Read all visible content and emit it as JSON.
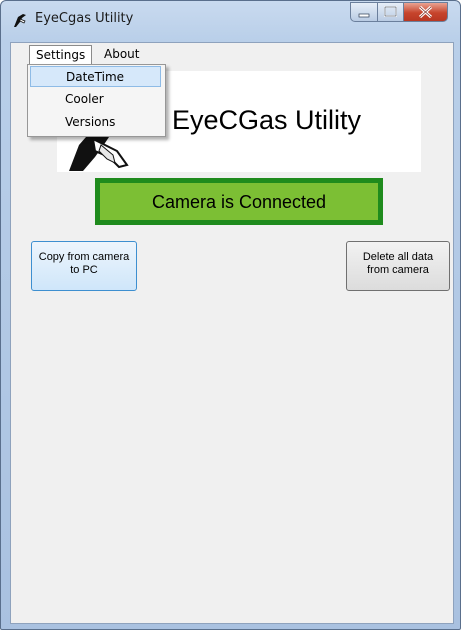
{
  "window": {
    "title": "EyeCgas Utility"
  },
  "menu": {
    "items": [
      {
        "label": "Settings"
      },
      {
        "label": "About"
      }
    ],
    "dropdown": [
      {
        "label": "DateTime",
        "selected": true
      },
      {
        "label": "Cooler"
      },
      {
        "label": "Versions"
      }
    ]
  },
  "logo": {
    "text": "EyeCGas Utility"
  },
  "status": {
    "text": "Camera is Connected",
    "color": "#7cbf34",
    "border_color": "#1f8b1d"
  },
  "buttons": {
    "copy": {
      "line1": "Copy from camera",
      "line2": "to PC"
    },
    "delete": {
      "line1": "Delete all data",
      "line2": "from camera"
    }
  },
  "icons": {
    "app": "bird-logo-icon",
    "minimize": "minimize-icon",
    "maximize": "maximize-icon",
    "close": "close-icon"
  }
}
